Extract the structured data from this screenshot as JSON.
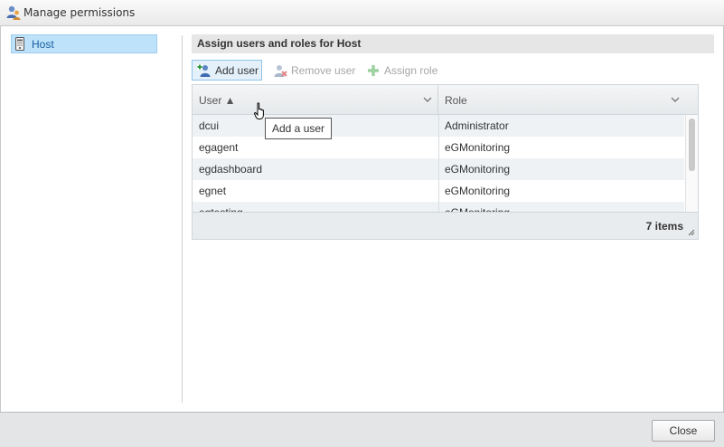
{
  "window": {
    "title": "Manage permissions",
    "icon": "users-permissions-icon"
  },
  "tree": {
    "items": [
      {
        "label": "Host",
        "icon": "host-server-icon",
        "selected": true
      }
    ]
  },
  "main": {
    "section_title": "Assign users and roles for Host",
    "toolbar": {
      "add_user": {
        "label": "Add user",
        "icon": "add-user-icon",
        "enabled": true
      },
      "remove_user": {
        "label": "Remove user",
        "icon": "remove-user-icon",
        "enabled": false
      },
      "assign_role": {
        "label": "Assign role",
        "icon": "plus-icon",
        "enabled": false
      }
    },
    "tooltip": "Add a user",
    "grid": {
      "columns": [
        {
          "label": "User ▲",
          "sorted": "ascending"
        },
        {
          "label": "Role"
        }
      ],
      "rows": [
        {
          "user": "dcui",
          "role": "Administrator"
        },
        {
          "user": "egagent",
          "role": "eGMonitoring"
        },
        {
          "user": "egdashboard",
          "role": "eGMonitoring"
        },
        {
          "user": "egnet",
          "role": "eGMonitoring"
        },
        {
          "user": "egtesting",
          "role": "eGMonitoring"
        }
      ],
      "items_count": "7 items"
    }
  },
  "footer": {
    "close_label": "Close"
  },
  "colors": {
    "selection": "#bde2f9",
    "selection_text": "#1a5fa3",
    "header_bg": "#e6e6e6",
    "footer_bg": "#e3e5e7"
  }
}
